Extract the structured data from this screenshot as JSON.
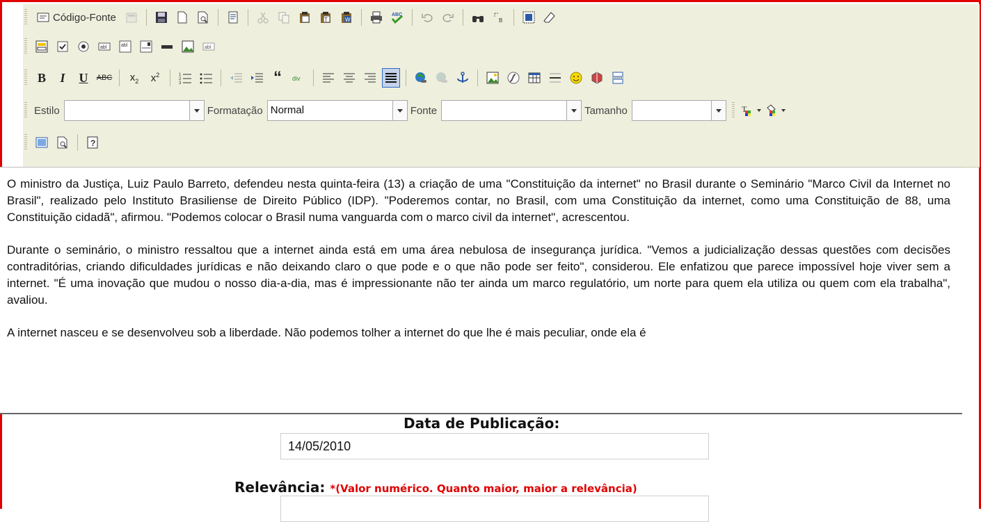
{
  "toolbar": {
    "source_label": "Código-Fonte",
    "style_label": "Estilo",
    "style_value": "",
    "format_label": "Formatação",
    "format_value": "Normal",
    "font_label": "Fonte",
    "font_value": "",
    "size_label": "Tamanho",
    "size_value": "",
    "accent_color": "#316ac5"
  },
  "content": {
    "paragraphs": [
      "O ministro da Justiça, Luiz Paulo Barreto, defendeu nesta quinta-feira (13) a criação de uma \"Constituição da internet\" no Brasil durante o Seminário \"Marco Civil da Internet no Brasil\", realizado pelo Instituto Brasiliense de Direito Público (IDP). \"Poderemos contar, no Brasil, com uma Constituição da internet, como uma Constituição de 88, uma Constituição cidadã\", afirmou. \"Podemos colocar o Brasil numa vanguarda com o marco civil da internet\", acrescentou.",
      "Durante o seminário, o ministro ressaltou que a internet ainda está em uma área nebulosa de insegurança jurídica. \"Vemos a judicialização dessas questões com decisões contraditórias, criando dificuldades jurídicas e não deixando claro o que pode e o que não pode ser feito\", considerou. Ele enfatizou que parece impossível hoje viver sem a internet. \"É uma inovação que mudou o nosso dia-a-dia, mas é impressionante não ter ainda um marco regulatório, um norte para quem ela utiliza ou quem com ela trabalha\", avaliou.",
      "A internet nasceu e se desenvolveu sob a liberdade. Não podemos tolher a internet do que lhe é mais peculiar, onde ela é"
    ]
  },
  "form": {
    "pub_date_label": "Data de Publicação:",
    "pub_date_value": "14/05/2010",
    "relevance_label": "Relevância:",
    "relevance_note": "*(Valor numérico. Quanto maior, maior a relevância)",
    "relevance_value": ""
  },
  "colors": {
    "frame": "#e00000",
    "toolbar_bg": "#efefde"
  }
}
